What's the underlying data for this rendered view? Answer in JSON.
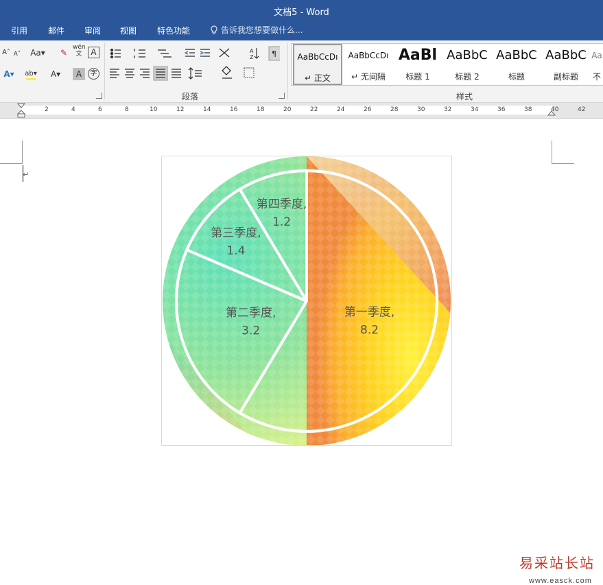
{
  "window": {
    "title": "文档5 - Word"
  },
  "tabs": [
    {
      "label": "引用"
    },
    {
      "label": "邮件"
    },
    {
      "label": "审阅"
    },
    {
      "label": "视图"
    },
    {
      "label": "特色功能"
    }
  ],
  "tell_me": {
    "placeholder": "告诉我您想要做什么..."
  },
  "ribbon": {
    "groups": [
      {
        "label": "段落"
      },
      {
        "label": "样式"
      }
    ],
    "font_buttons": {
      "aa": "Aa",
      "pinyin": "wén",
      "pinyin_char": "文",
      "font_color": "A",
      "char_shading": "A",
      "enclose": "字"
    },
    "styles": [
      {
        "preview": "AaBbCcDı",
        "name": "正文"
      },
      {
        "preview": "AaBbCcDı",
        "name": "无间隔"
      },
      {
        "preview": "AaBl",
        "name": "标题 1"
      },
      {
        "preview": "AaBbC",
        "name": "标题 2"
      },
      {
        "preview": "AaBbC",
        "name": "标题"
      },
      {
        "preview": "AaBbC",
        "name": "副标题"
      },
      {
        "preview": "Aa",
        "name": "不"
      }
    ]
  },
  "ruler": {
    "numbers": [
      "2",
      "4",
      "6",
      "8",
      "10",
      "12",
      "14",
      "16",
      "18",
      "20",
      "22",
      "24",
      "26",
      "28",
      "30",
      "32",
      "34",
      "36",
      "38",
      "40",
      "42"
    ]
  },
  "chart_data": {
    "type": "pie",
    "categories": [
      "第一季度",
      "第二季度",
      "第三季度",
      "第四季度"
    ],
    "values": [
      8.2,
      3.2,
      1.4,
      1.2
    ],
    "data_labels": [
      "第一季度,\n8.2",
      "第二季度,\n3.2",
      "第三季度,\n1.4",
      "第四季度,\n1.2"
    ],
    "legend": "none",
    "fill": "gradient texture (green-yellow-orange-red)"
  },
  "colors": {
    "title_bar": "#2b579a",
    "ribbon": "#f3f3f3",
    "watermark": "#c0392b"
  },
  "watermark": {
    "text": "易采站长站",
    "url": "www.easck.com"
  }
}
